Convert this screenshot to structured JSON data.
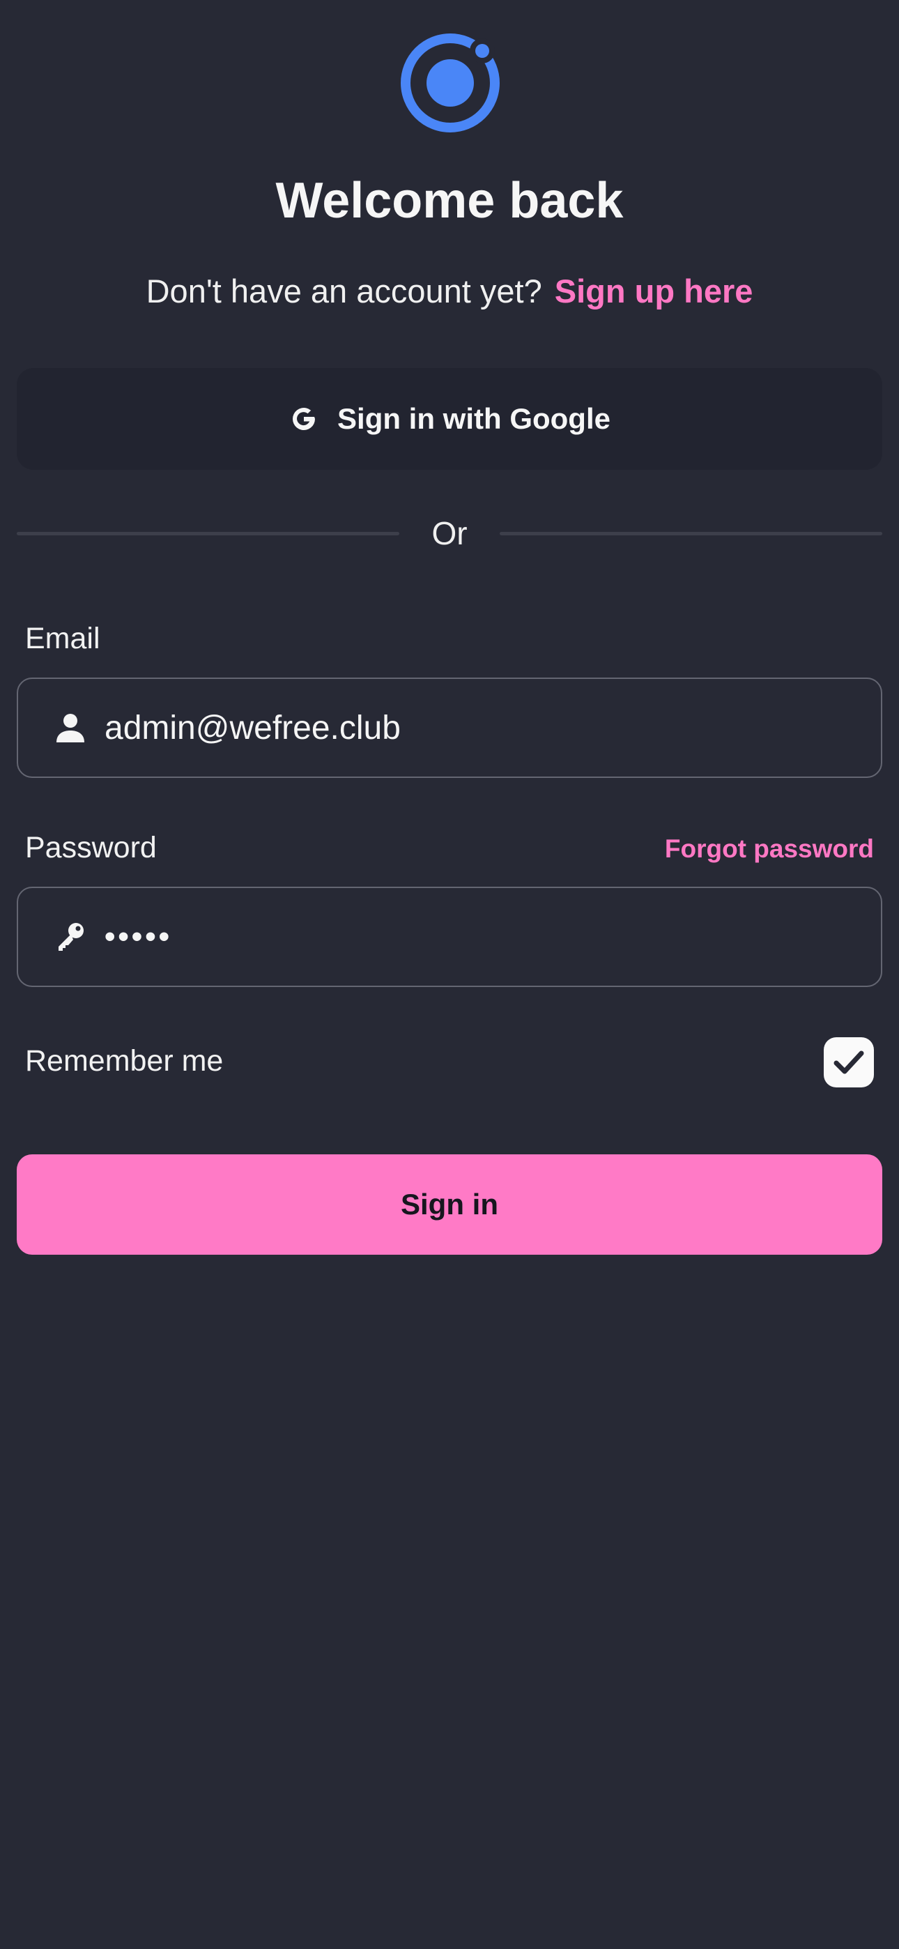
{
  "header": {
    "title": "Welcome back",
    "signup_prompt": "Don't have an account yet?",
    "signup_link": "Sign up here"
  },
  "google": {
    "label": "Sign in with Google",
    "icon": "google-icon"
  },
  "divider": {
    "label": "Or"
  },
  "email": {
    "label": "Email",
    "value": "admin@wefree.club",
    "icon": "user-icon"
  },
  "password": {
    "label": "Password",
    "value": "•••••",
    "forgot_label": "Forgot password",
    "icon": "key-icon"
  },
  "remember": {
    "label": "Remember me",
    "checked": true
  },
  "submit": {
    "label": "Sign in"
  },
  "colors": {
    "background": "#272935",
    "accent": "#ff78c4",
    "logo": "#4a86f7"
  }
}
